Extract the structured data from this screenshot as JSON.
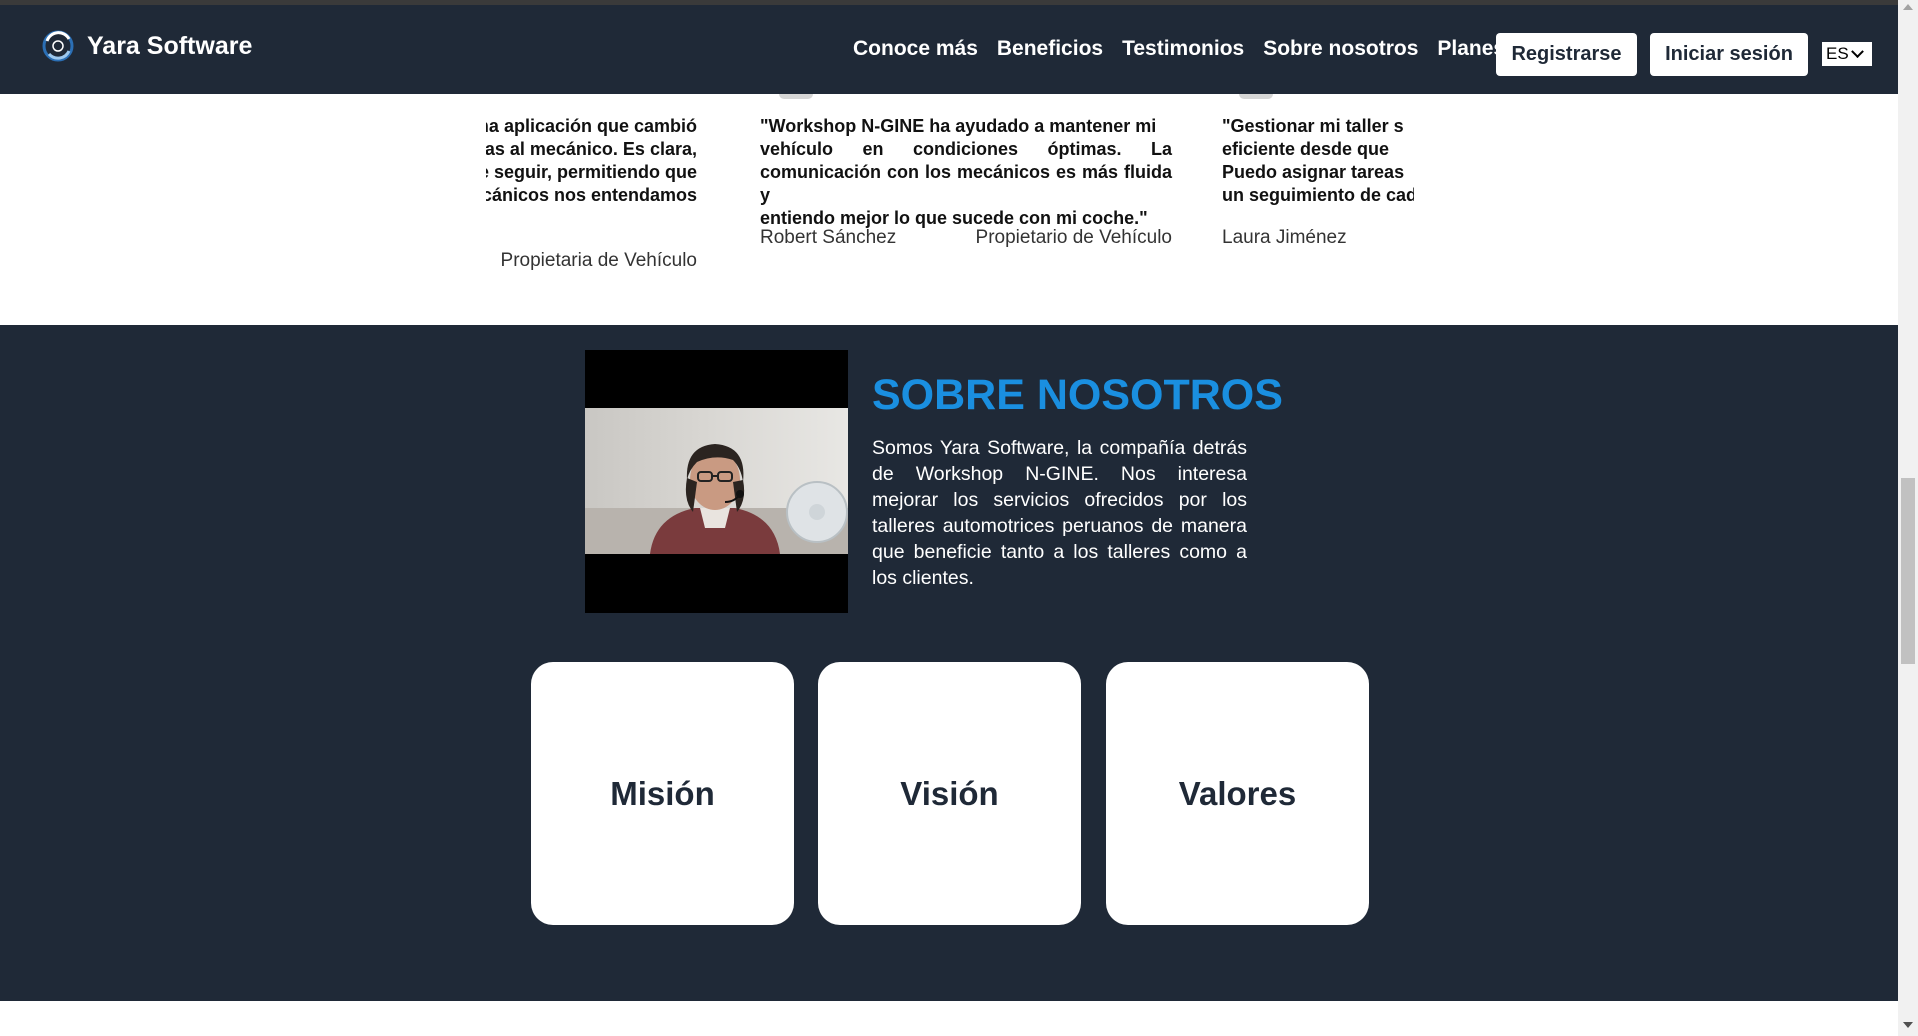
{
  "nav": {
    "brand": "Yara Software",
    "links": [
      "Conoce más",
      "Beneficios",
      "Testimonios",
      "Sobre nosotros",
      "Planes"
    ],
    "register": "Registrarse",
    "login": "Iniciar sesión",
    "language": "ES"
  },
  "testimonials": [
    {
      "quote_lines": [
        "una aplicación que cambió",
        "tas al mecánico. Es clara,",
        "e seguir, permitiendo que",
        "ecánicos nos entendamos"
      ],
      "name": "",
      "role": "Propietaria de Vehículo"
    },
    {
      "quote_lines": [
        "\"Workshop N-GINE ha ayudado a mantener mi",
        "vehículo en condiciones óptimas. La",
        "comunicación con los mecánicos es más fluida y",
        "entiendo mejor lo que sucede con mi coche.\""
      ],
      "name": "Robert Sánchez",
      "role": "Propietario de Vehículo"
    },
    {
      "quote_lines": [
        "\"Gestionar mi taller s",
        "eficiente desde que",
        "Puedo asignar tareas",
        "un seguimiento de cad"
      ],
      "name": "Laura Jiménez",
      "role": ""
    }
  ],
  "about": {
    "title": "SOBRE NOSOTROS",
    "text": "Somos Yara Software, la compañía detrás de Workshop N-GINE. Nos interesa mejorar los servicios ofrecidos por los talleres automotrices peruanos de manera que beneficie tanto a los talleres como a los clientes.",
    "cards": [
      "Misión",
      "Visión",
      "Valores"
    ]
  },
  "colors": {
    "navy": "#1f2937",
    "accent": "#1a8fe0",
    "white": "#ffffff"
  }
}
